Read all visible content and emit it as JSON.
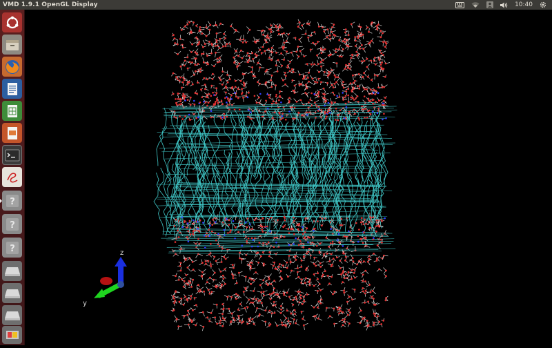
{
  "window": {
    "title": "VMD 1.9.1 OpenGL Display"
  },
  "panel": {
    "clock": "10:40"
  },
  "launcher": {
    "items": [
      {
        "name": "ubuntu-dash-icon"
      },
      {
        "name": "files-icon"
      },
      {
        "name": "firefox-icon"
      },
      {
        "name": "libreoffice-writer-icon"
      },
      {
        "name": "libreoffice-calc-icon"
      },
      {
        "name": "libreoffice-impress-icon"
      },
      {
        "name": "terminal-icon"
      },
      {
        "name": "text-editor-icon"
      },
      {
        "name": "unknown-app-icon"
      },
      {
        "name": "unknown-app-icon"
      },
      {
        "name": "unknown-app-icon"
      },
      {
        "name": "drive-icon"
      },
      {
        "name": "drive-icon"
      },
      {
        "name": "drive-icon"
      },
      {
        "name": "scanner-icon"
      }
    ]
  },
  "axes": {
    "z_label": "z",
    "y_label": "y"
  },
  "colors": {
    "lipid": "#40c8c8",
    "water_o": "#e03030",
    "water_h": "#e8e8e8",
    "nitrogen": "#3040ff",
    "background": "#000000"
  }
}
